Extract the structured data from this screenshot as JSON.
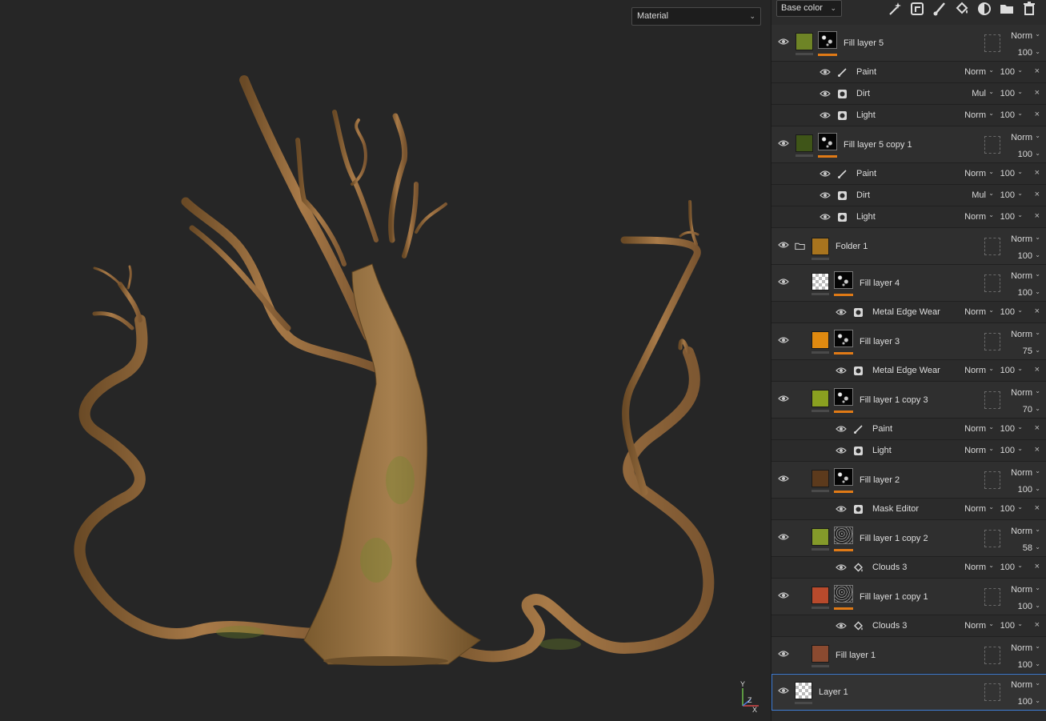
{
  "viewport": {
    "mode_select": "Material"
  },
  "axis_gizmo": {
    "y_label": "Y",
    "x_label": "X",
    "z_label": "Z"
  },
  "toolbar": {
    "channel_select": "Base color",
    "tools": [
      "magic-wand-icon",
      "add-effect-icon",
      "paint-brush-icon",
      "fill-bucket-icon",
      "add-mask-icon",
      "folder-icon",
      "trash-icon"
    ]
  },
  "layers": [
    {
      "name": "Fill layer 5",
      "blend": "Norm",
      "opacity": "100",
      "color": "#6e8426",
      "mask": true,
      "effects": [
        {
          "name": "Paint",
          "icon": "brush",
          "blend": "Norm",
          "opacity": "100"
        },
        {
          "name": "Dirt",
          "icon": "gen",
          "blend": "Mul",
          "opacity": "100"
        },
        {
          "name": "Light",
          "icon": "gen",
          "blend": "Norm",
          "opacity": "100"
        }
      ]
    },
    {
      "name": "Fill layer 5 copy 1",
      "blend": "Norm",
      "opacity": "100",
      "color": "#3f5518",
      "mask": true,
      "effects": [
        {
          "name": "Paint",
          "icon": "brush",
          "blend": "Norm",
          "opacity": "100"
        },
        {
          "name": "Dirt",
          "icon": "gen",
          "blend": "Mul",
          "opacity": "100"
        },
        {
          "name": "Light",
          "icon": "gen",
          "blend": "Norm",
          "opacity": "100"
        }
      ]
    },
    {
      "name": "Folder 1",
      "blend": "Norm",
      "opacity": "100",
      "color": "#a8741e",
      "folder": true,
      "effects": []
    },
    {
      "name": "Fill layer 4",
      "blend": "Norm",
      "opacity": "100",
      "color": "checker",
      "mask": true,
      "indent": true,
      "effects": [
        {
          "name": "Metal Edge Wear",
          "icon": "gen",
          "blend": "Norm",
          "opacity": "100"
        }
      ]
    },
    {
      "name": "Fill layer 3",
      "blend": "Norm",
      "opacity": "75",
      "color": "#e08a10",
      "mask": true,
      "indent": true,
      "effects": [
        {
          "name": "Metal Edge Wear",
          "icon": "gen",
          "blend": "Norm",
          "opacity": "100"
        }
      ]
    },
    {
      "name": "Fill layer 1 copy 3",
      "blend": "Norm",
      "opacity": "70",
      "color": "#8aa020",
      "mask": true,
      "indent": true,
      "effects": [
        {
          "name": "Paint",
          "icon": "brush",
          "blend": "Norm",
          "opacity": "100"
        },
        {
          "name": "Light",
          "icon": "gen",
          "blend": "Norm",
          "opacity": "100"
        }
      ]
    },
    {
      "name": "Fill layer 2",
      "blend": "Norm",
      "opacity": "100",
      "color": "#5c3a1c",
      "mask": true,
      "indent": true,
      "effects": [
        {
          "name": "Mask Editor",
          "icon": "gen",
          "blend": "Norm",
          "opacity": "100"
        }
      ]
    },
    {
      "name": "Fill layer 1 copy 2",
      "blend": "Norm",
      "opacity": "58",
      "color": "#849a2a",
      "mask": true,
      "indent": true,
      "noise": true,
      "effects": [
        {
          "name": "Clouds 3",
          "icon": "fill",
          "blend": "Norm",
          "opacity": "100"
        }
      ]
    },
    {
      "name": "Fill layer 1 copy 1",
      "blend": "Norm",
      "opacity": "100",
      "color": "#b84a2c",
      "mask": true,
      "indent": true,
      "noise": true,
      "effects": [
        {
          "name": "Clouds 3",
          "icon": "fill",
          "blend": "Norm",
          "opacity": "100"
        }
      ]
    },
    {
      "name": "Fill layer 1",
      "blend": "Norm",
      "opacity": "100",
      "color": "#8a4a30",
      "effects": []
    },
    {
      "name": "Layer 1",
      "blend": "Norm",
      "opacity": "100",
      "color": "checker",
      "selected": true,
      "effects": []
    }
  ]
}
